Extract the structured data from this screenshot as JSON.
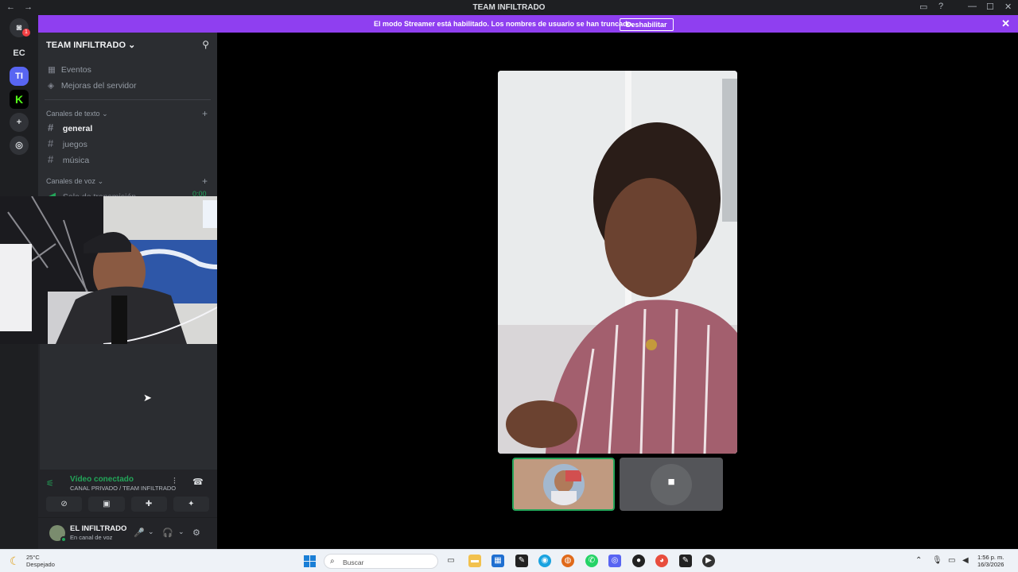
{
  "window": {
    "title": "TEAM INFILTRADO",
    "back": "←",
    "forward": "→",
    "inbox_icon": "inbox-icon",
    "help": "?",
    "minimize": "—",
    "maximize": "☐",
    "close": "✕"
  },
  "banner": {
    "text": "El modo Streamer está habilitado. Los nombres de usuario se han truncado.",
    "button": "Deshabilitar",
    "close": "✕",
    "color": "#8f3ff0"
  },
  "rail": {
    "badge": "1",
    "ec": "EC",
    "ti": "TI",
    "kick": "K",
    "add": "+",
    "discover": "◎"
  },
  "sidebar": {
    "server_name": "TEAM INFILTRADO",
    "server_chevron": "⌄",
    "events": "Eventos",
    "boosts": "Mejoras del servidor",
    "text_category": "Canales de texto",
    "voice_category": "Canales de voz",
    "plus": "+",
    "channels": [
      {
        "name": "general",
        "hash": "#"
      },
      {
        "name": "juegos",
        "hash": "#"
      },
      {
        "name": "música",
        "hash": "#"
      }
    ],
    "voice_channel": "Sala de transmisión",
    "voice_time": "0:00"
  },
  "voice": {
    "status": "Vídeo conectado",
    "path": "CANAL PRIVADO / TEAM INFILTRADO",
    "soundboard": "⫶",
    "disconnect": "☎",
    "buttons": [
      "⊘",
      "▣",
      "✚",
      "✦"
    ]
  },
  "user": {
    "name": "EL INFILTRADO",
    "status": "En canal de voz",
    "mic": "🎤",
    "headphones": "🎧",
    "chevron": "⌄",
    "gear": "⚙"
  },
  "stage": {
    "camera_icon": "■"
  },
  "taskbar": {
    "temp": "25°C",
    "weather": "Despejado",
    "search_placeholder": "Buscar",
    "search_icon": "⌕",
    "time": "1:56 p. m.",
    "date": "16/3/2026",
    "chevron_up": "⌃",
    "apps": [
      "▭",
      "▬",
      "▦",
      "✎",
      "◉",
      "◍",
      "✆",
      "◎",
      "●",
      "◕",
      "✎",
      "▶"
    ]
  }
}
